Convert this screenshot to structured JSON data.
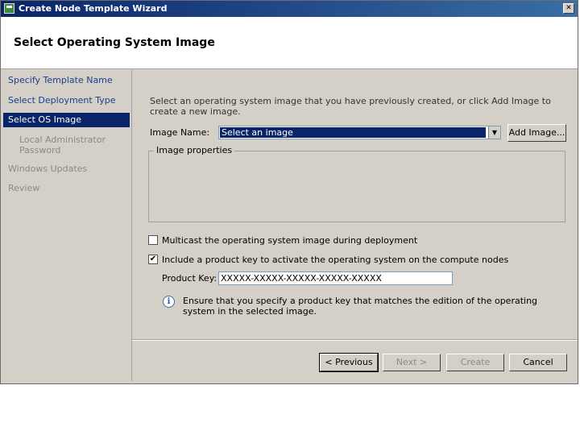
{
  "window": {
    "title": "Create Node Template Wizard",
    "close_label": "✕"
  },
  "header": {
    "title": "Select Operating System Image"
  },
  "sidebar": {
    "items": [
      {
        "label": "Specify Template Name",
        "state": "link"
      },
      {
        "label": "Select Deployment Type",
        "state": "link"
      },
      {
        "label": "Select OS Image",
        "state": "active"
      },
      {
        "label": "Local Administrator",
        "label2": "Password",
        "state": "disabled"
      },
      {
        "label": "Windows Updates",
        "state": "disabled"
      },
      {
        "label": "Review",
        "state": "disabled"
      }
    ]
  },
  "main": {
    "intro": "Select an operating system image that you have previously created, or click Add Image to create a new image.",
    "image_name_label": "Image Name:",
    "image_select_value": "Select an image",
    "add_image_label": "Add Image...",
    "image_properties_label": "Image properties",
    "multicast_label": "Multicast the operating system image during deployment",
    "multicast_checked": false,
    "product_key_checkbox_label": "Include a product key to activate the operating system on the compute nodes",
    "product_key_checked": true,
    "product_key_label": "Product Key:",
    "product_key_value": "XXXXX-XXXXX-XXXXX-XXXXX-XXXXX",
    "info_text": "Ensure that you specify a product key that matches the edition of the operating system in the selected image."
  },
  "footer": {
    "previous_label": "< Previous",
    "next_label": "Next >",
    "create_label": "Create",
    "cancel_label": "Cancel"
  },
  "colors": {
    "accent": "#0a246a",
    "face": "#d4d0c8",
    "link": "#1a3e92"
  },
  "icons": {
    "info": "info-icon",
    "dropdown": "chevron-down-icon",
    "check": "check-icon"
  }
}
